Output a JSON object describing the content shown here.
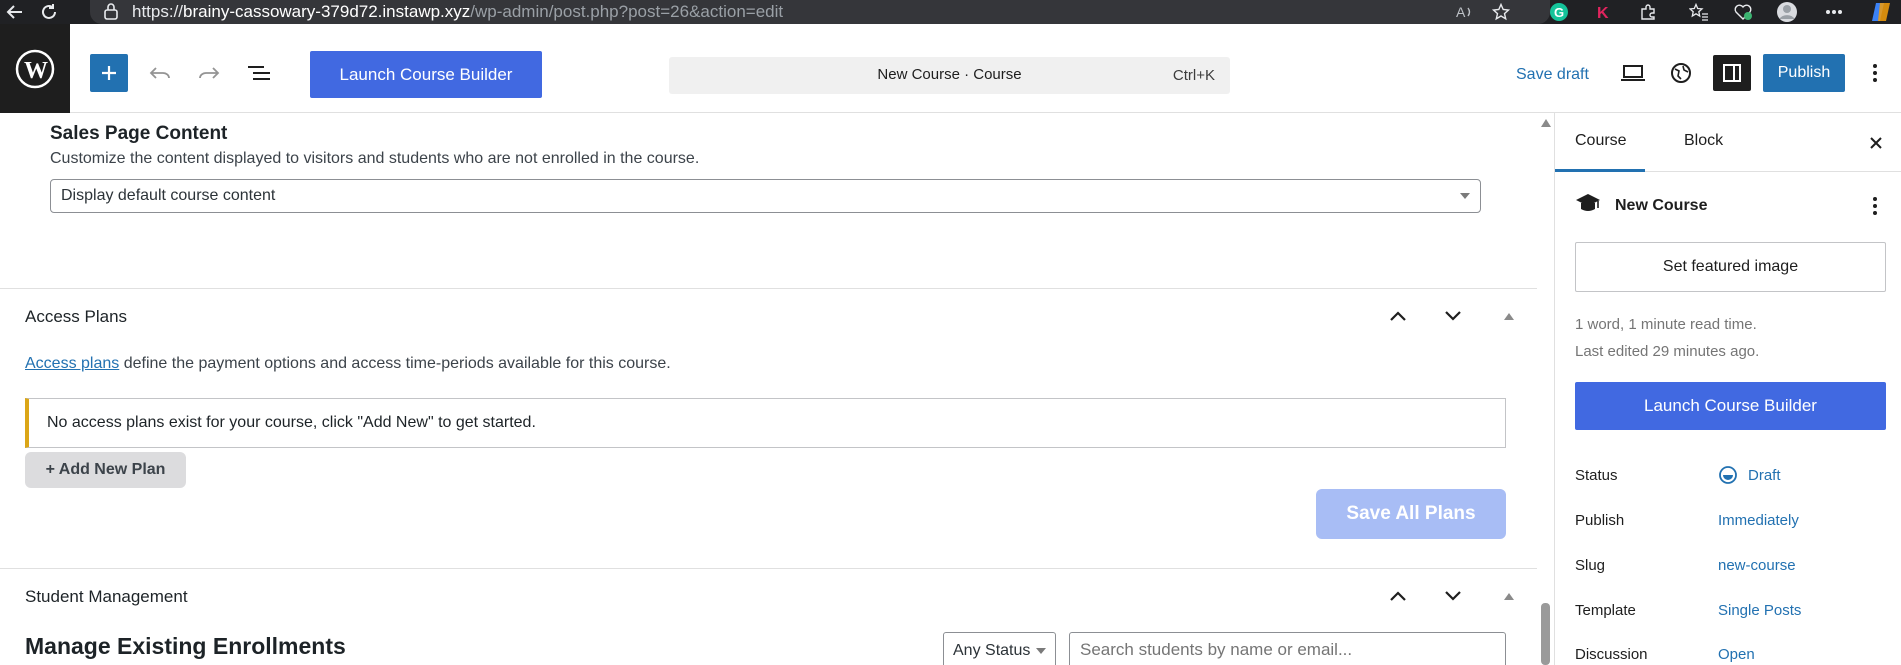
{
  "browser": {
    "url_protocol": "https://",
    "url_host": "brainy-cassowary-379d72.instawp.xyz",
    "url_path": "/wp-admin/post.php?post=26&action=edit"
  },
  "toolbar": {
    "launch_builder_label": "Launch Course Builder",
    "command_title": "New Course · Course",
    "command_shortcut": "Ctrl+K",
    "save_draft_label": "Save draft",
    "publish_label": "Publish"
  },
  "sales_page": {
    "heading": "Sales Page Content",
    "description": "Customize the content displayed to visitors and students who are not enrolled in the course.",
    "selected_option": "Display default course content"
  },
  "access_plans": {
    "title": "Access Plans",
    "link_text": "Access plans",
    "description_rest": " define the payment options and access time-periods available for this course.",
    "notice": "No access plans exist for your course, click \"Add New\" to get started.",
    "add_new_label": "+ Add New Plan",
    "save_all_label": "Save All Plans"
  },
  "student_management": {
    "title": "Student Management",
    "heading": "Manage Existing Enrollments",
    "status_filter": "Any Status",
    "search_placeholder": "Search students by name or email..."
  },
  "sidebar": {
    "tabs": [
      {
        "label": "Course",
        "active": true
      },
      {
        "label": "Block",
        "active": false
      }
    ],
    "post_title": "New Course",
    "featured_image_label": "Set featured image",
    "read_time": "1 word, 1 minute read time.",
    "last_edited": "Last edited 29 minutes ago.",
    "launch_builder_label": "Launch Course Builder",
    "rows": [
      {
        "label": "Status",
        "value": "Draft"
      },
      {
        "label": "Publish",
        "value": "Immediately"
      },
      {
        "label": "Slug",
        "value": "new-course"
      },
      {
        "label": "Template",
        "value": "Single Posts"
      },
      {
        "label": "Discussion",
        "value": "Open"
      }
    ]
  },
  "colors": {
    "accent": "#2271b1",
    "builder_button": "#4169e1",
    "notice_border": "#dba617",
    "disabled_button": "#a8bdf5"
  }
}
